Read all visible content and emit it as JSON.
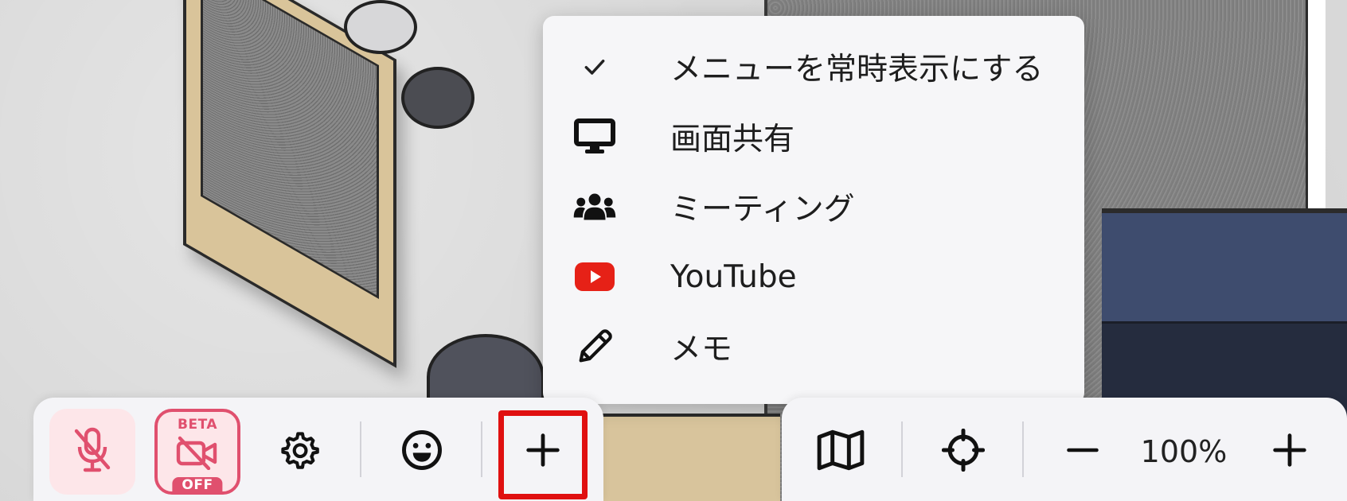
{
  "menu": {
    "items": [
      {
        "label": "メニューを常時表示にする",
        "icon": "check-icon"
      },
      {
        "label": "画面共有",
        "icon": "monitor-icon"
      },
      {
        "label": "ミーティング",
        "icon": "users-icon"
      },
      {
        "label": "YouTube",
        "icon": "youtube-icon"
      },
      {
        "label": "メモ",
        "icon": "pencil-icon"
      }
    ]
  },
  "toolbar": {
    "mic": {
      "icon": "mic-off-icon",
      "state": "off"
    },
    "camera": {
      "icon": "video-off-icon",
      "badge_top": "BETA",
      "badge_bottom": "OFF"
    },
    "settings": {
      "icon": "gear-icon"
    },
    "reaction": {
      "icon": "smile-icon"
    },
    "add": {
      "icon": "plus-icon",
      "highlighted": true
    }
  },
  "map_controls": {
    "map": {
      "icon": "map-icon"
    },
    "locate": {
      "icon": "crosshair-icon"
    },
    "zoom_out": {
      "icon": "minus-icon"
    },
    "zoom_level": "100%",
    "zoom_in": {
      "icon": "plus-icon"
    }
  },
  "colors": {
    "accent_pink": "#e0506e",
    "highlight_red": "#e01010",
    "youtube_red": "#e62117"
  }
}
